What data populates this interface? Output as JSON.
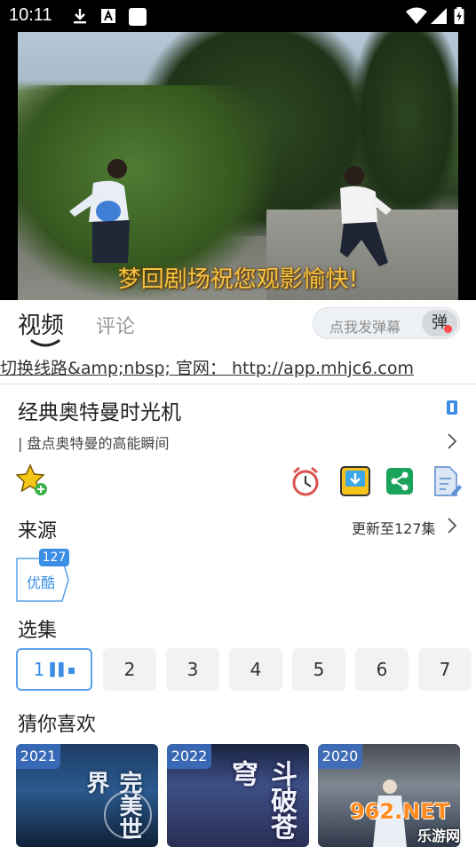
{
  "status_bar": {
    "time": "10:11"
  },
  "player": {
    "subtitle": "梦回剧场祝您观影愉快!"
  },
  "tabs": {
    "video": "视频",
    "comment": "评论"
  },
  "danmu": {
    "placeholder": "点我发弹幕",
    "button": "弹"
  },
  "notice": "切换线路&amp;nbsp; 官网： http://app.mhjc6.com",
  "show": {
    "title": "经典奥特曼时光机",
    "subtitle": "| 盘点奥特曼的高能瞬间"
  },
  "actions": [
    "favorite-add",
    "alarm",
    "download",
    "share",
    "edit-note"
  ],
  "source": {
    "title": "来源",
    "update_text": "更新至127集",
    "items": [
      {
        "label": "优酷",
        "count": "127"
      }
    ]
  },
  "episodes": {
    "title": "选集",
    "items": [
      "1",
      "2",
      "3",
      "4",
      "5",
      "6",
      "7"
    ]
  },
  "recommend": {
    "title": "猜你喜欢",
    "items": [
      {
        "year": "2021",
        "title": "完美世界"
      },
      {
        "year": "2022",
        "title": "斗破苍穹"
      },
      {
        "year": "2020",
        "title": ""
      }
    ]
  },
  "watermark": {
    "top": "962.NET",
    "bottom": "乐游网"
  },
  "colors": {
    "accent": "#3a8ee6",
    "subtitle": "#f6c441"
  }
}
